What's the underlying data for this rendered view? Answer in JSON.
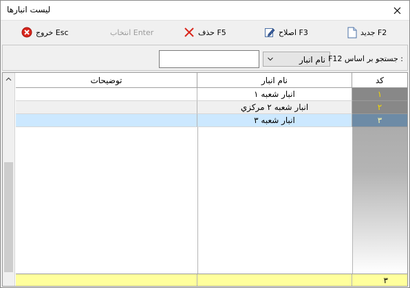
{
  "window": {
    "title": "لیست انبارها"
  },
  "toolbar": {
    "new_label": "جدید F2",
    "edit_label": "اصلاح F3",
    "delete_label": "حذف F5",
    "select_label": "انتخاب Enter",
    "exit_label": "خروج Esc"
  },
  "search": {
    "label": "F12 جستجو بر اساس :",
    "field_selected": "نام انبار",
    "input_value": ""
  },
  "table": {
    "headers": {
      "code": "کد",
      "name": "نام انبار",
      "description": "توضیحات"
    },
    "rows": [
      {
        "code": "۱",
        "name": "انبار شعبه ۱",
        "description": ""
      },
      {
        "code": "۲",
        "name": "انبار شعبه ۲ مرکزي",
        "description": ""
      },
      {
        "code": "۳",
        "name": "انبار شعبه ۳",
        "description": ""
      }
    ],
    "footer_count": "۳"
  },
  "colors": {
    "code_text": "#f5d800",
    "selected_row": "#cce8ff",
    "footer_bg": "#ffff9c",
    "delete_icon": "#d9261c",
    "exit_icon": "#d9261c"
  },
  "icons": {
    "new": "document-icon",
    "edit": "edit-pencil-icon",
    "delete": "red-x-icon",
    "exit": "exit-circle-icon",
    "close": "close-icon"
  }
}
